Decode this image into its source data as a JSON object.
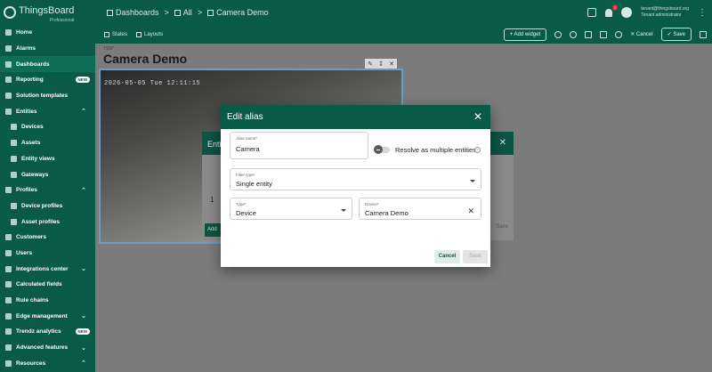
{
  "topbar": {
    "logo_text": "ThingsBoard",
    "logo_sub": "Professional",
    "breadcrumbs": [
      "Dashboards",
      "All",
      "Camera Demo"
    ],
    "notifications_count": "2",
    "user_email": "tenant@thingsboard.org",
    "user_role": "Tenant administrator"
  },
  "sidebar": {
    "items": [
      {
        "label": "Home"
      },
      {
        "label": "Alarms"
      },
      {
        "label": "Dashboards"
      },
      {
        "label": "Reporting",
        "badge": "NEW"
      },
      {
        "label": "Solution templates"
      },
      {
        "label": "Entities"
      },
      {
        "label": "Devices"
      },
      {
        "label": "Assets"
      },
      {
        "label": "Entity views"
      },
      {
        "label": "Gateways"
      },
      {
        "label": "Profiles"
      },
      {
        "label": "Device profiles"
      },
      {
        "label": "Asset profiles"
      },
      {
        "label": "Customers"
      },
      {
        "label": "Users"
      },
      {
        "label": "Integrations center"
      },
      {
        "label": "Calculated fields"
      },
      {
        "label": "Rule chains"
      },
      {
        "label": "Edge management"
      },
      {
        "label": "Trendz analytics",
        "badge": "NEW"
      },
      {
        "label": "Advanced features"
      },
      {
        "label": "Resources"
      }
    ]
  },
  "toolbar": {
    "states": "States",
    "layouts": "Layouts",
    "add_widget": "Add widget",
    "cancel": "Cancel",
    "save": "Save"
  },
  "dashboard": {
    "label": "TSN*",
    "title": "Camera Demo",
    "camera_timestamp": "2026-05-05 Tue 12:11:15"
  },
  "background_dialog": {
    "title": "Enti",
    "row_number": "1",
    "add_label": "Add",
    "save_label": "Save"
  },
  "modal": {
    "title": "Edit alias",
    "alias_name_label": "Alias name*",
    "alias_name_value": "Camera",
    "resolve_label": "Resolve as multiple entities",
    "filter_type_label": "Filter type*",
    "filter_type_value": "Single entity",
    "type_label": "Type*",
    "type_value": "Device",
    "device_label": "Device*",
    "device_value": "Camera Demo",
    "cancel": "Cancel",
    "save": "Save"
  },
  "colors": {
    "primary": "#0a5a48",
    "overlay": "#7b7b7b"
  }
}
